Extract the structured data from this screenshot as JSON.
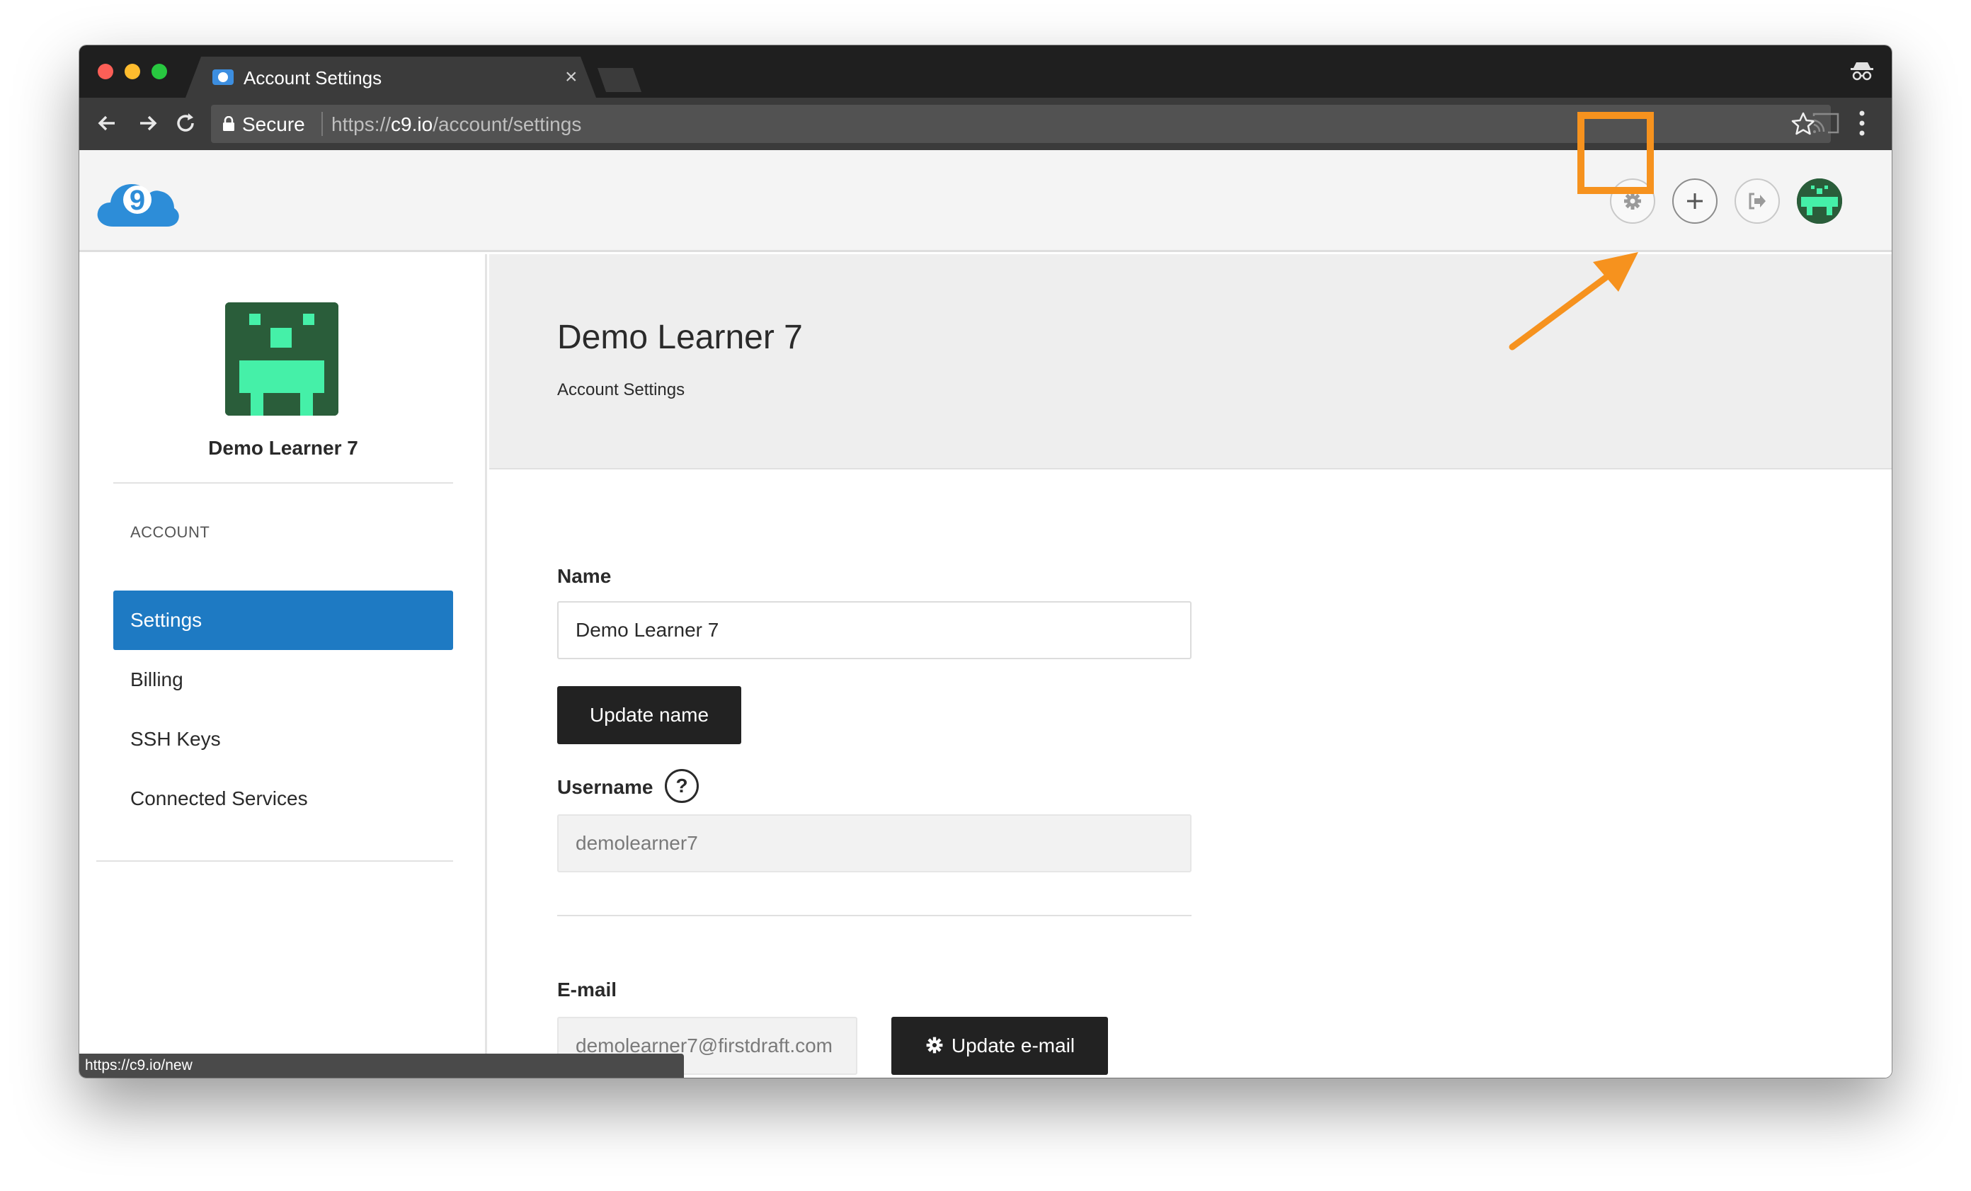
{
  "browser": {
    "tab_title": "Account Settings",
    "tab_close": "×",
    "secure_label": "Secure",
    "url_scheme": "https://",
    "url_host": "c9.io",
    "url_path": "/account/settings",
    "status_url": "https://c9.io/new"
  },
  "header": {
    "icons": [
      "settings-gear-icon",
      "plus-icon",
      "logout-icon",
      "user-avatar"
    ],
    "highlight_color": "#f6921e"
  },
  "sidebar": {
    "user_name": "Demo Learner 7",
    "section_label": "ACCOUNT",
    "items": [
      {
        "label": "Settings",
        "active": true
      },
      {
        "label": "Billing",
        "active": false
      },
      {
        "label": "SSH Keys",
        "active": false
      },
      {
        "label": "Connected Services",
        "active": false
      }
    ],
    "active_color": "#1e7ac3"
  },
  "main": {
    "title": "Demo Learner 7",
    "subtitle": "Account Settings",
    "name_label": "Name",
    "name_value": "Demo Learner 7",
    "update_name_label": "Update name",
    "username_label": "Username",
    "help_glyph": "?",
    "username_value": "demolearner7",
    "email_label": "E-mail",
    "email_value": "demolearner7@firstdraft.com",
    "update_email_label": "Update e-mail"
  }
}
